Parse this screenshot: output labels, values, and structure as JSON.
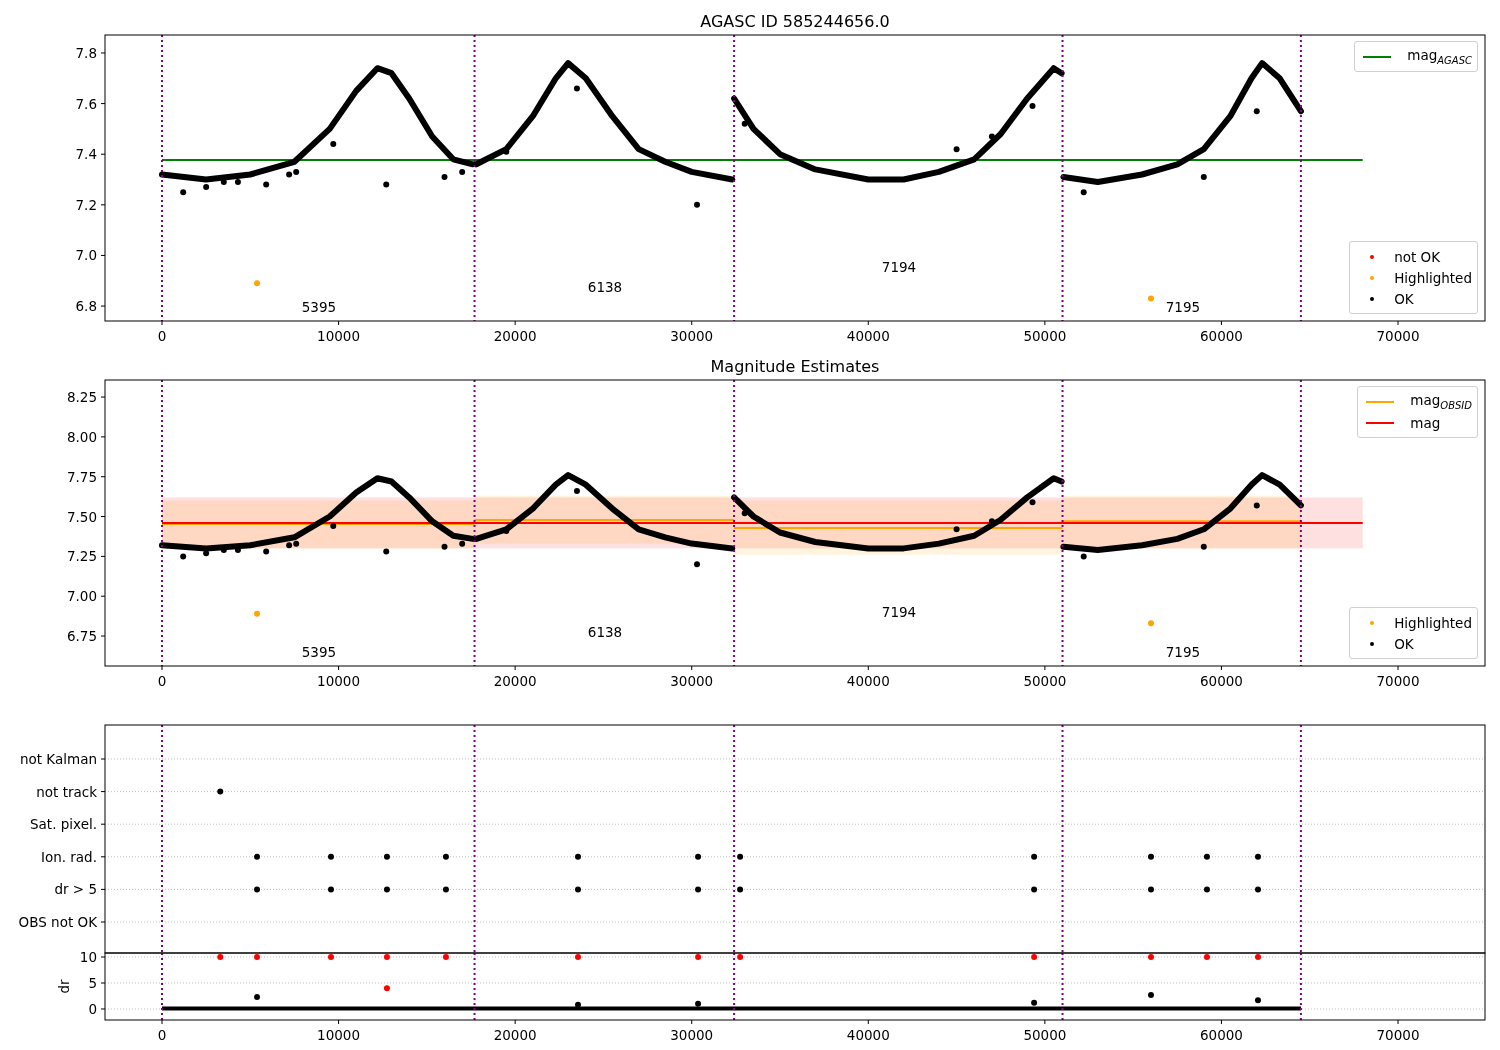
{
  "panels": [
    {
      "chart_data": {
        "type": "scatter",
        "title": "AGASC ID 585244656.0",
        "xlim": [
          -3228,
          74926
        ],
        "ylim": [
          6.741,
          7.871
        ],
        "xticks": [
          0,
          10000,
          20000,
          30000,
          40000,
          50000,
          60000,
          70000
        ],
        "yticks": [
          {
            "value": 6.8,
            "label": "6.8"
          },
          {
            "value": 7.0,
            "label": "7.0"
          },
          {
            "value": 7.2,
            "label": "7.2"
          },
          {
            "value": 7.4,
            "label": "7.4"
          },
          {
            "value": 7.6,
            "label": "7.6"
          },
          {
            "value": 7.8,
            "label": "7.8"
          }
        ],
        "series": [
          {
            "name": "mag$_{AGASC}$",
            "type": "line",
            "color": "#008000",
            "x": [
              0,
              68000
            ],
            "values": [
              7.377,
              7.377
            ]
          },
          {
            "name": "not OK",
            "type": "scatter",
            "color": "#ff0000"
          },
          {
            "type": "line",
            "color": "#000000",
            "x": [
              0,
              2500,
              5000,
              7500,
              9500,
              11000,
              12200,
              13000,
              14000,
              15300,
              16500,
              17600,
              17650,
              17800,
              19500,
              21000,
              22300,
              23000,
              24000,
              25500,
              27000,
              28500,
              30000,
              32300,
              32350,
              32400,
              33500,
              35000,
              37000,
              40000,
              42000,
              44000,
              46000,
              47500,
              49000,
              50500,
              50950,
              50975,
              51050,
              53000,
              55500,
              57500,
              59000,
              60500,
              61700,
              62300,
              63300,
              64500
            ],
            "values": [
              7.32,
              7.3,
              7.32,
              7.37,
              7.5,
              7.65,
              7.74,
              7.72,
              7.62,
              7.47,
              7.38,
              7.36,
              null,
              7.36,
              7.42,
              7.55,
              7.7,
              7.76,
              7.7,
              7.55,
              7.42,
              7.37,
              7.33,
              7.3,
              null,
              7.62,
              7.5,
              7.4,
              7.34,
              7.3,
              7.3,
              7.33,
              7.38,
              7.48,
              7.62,
              7.74,
              7.72,
              null,
              7.31,
              7.29,
              7.32,
              7.36,
              7.42,
              7.55,
              7.7,
              7.76,
              7.7,
              7.57
            ]
          },
          {
            "name": "Highlighted",
            "type": "scatter",
            "color": "#ffa500",
            "x": [
              5380,
              56010
            ],
            "values": [
              6.89,
              6.83
            ]
          },
          {
            "name": "OK",
            "type": "scatter",
            "color": "#000000",
            "x": [
              1200,
              2500,
              3500,
              4300,
              5900,
              7200,
              7600,
              9700,
              12700,
              16000,
              17000,
              19500,
              23500,
              30300,
              33000,
              45000,
              47000,
              49300,
              52200,
              59000,
              62000
            ],
            "values": [
              7.25,
              7.27,
              7.29,
              7.29,
              7.28,
              7.32,
              7.33,
              7.44,
              7.28,
              7.31,
              7.33,
              7.41,
              7.66,
              7.2,
              7.52,
              7.42,
              7.47,
              7.59,
              7.25,
              7.31,
              7.57
            ]
          }
        ],
        "ref_lines": [
          {
            "axis": "x",
            "value": 0
          },
          {
            "axis": "x",
            "value": 17700
          },
          {
            "axis": "x",
            "value": 32400
          },
          {
            "axis": "x",
            "value": 51000
          },
          {
            "axis": "x",
            "value": 64500
          }
        ],
        "annotations": [
          "5395",
          "6138",
          "7194",
          "7195"
        ]
      }
    },
    {
      "chart_data": {
        "type": "scatter",
        "title": "Magnitude Estimates",
        "xlim": [
          -3228,
          74926
        ],
        "ylim": [
          6.562,
          8.357
        ],
        "xticks": [
          0,
          10000,
          20000,
          30000,
          40000,
          50000,
          60000,
          70000
        ],
        "yticks": [
          {
            "value": 6.75,
            "label": "6.75"
          },
          {
            "value": 7.0,
            "label": "7.00"
          },
          {
            "value": 7.25,
            "label": "7.25"
          },
          {
            "value": 7.5,
            "label": "7.50"
          },
          {
            "value": 7.75,
            "label": "7.75"
          },
          {
            "value": 8.0,
            "label": "8.00"
          },
          {
            "value": 8.25,
            "label": "8.25"
          }
        ],
        "bands": [
          {
            "axis": "y",
            "from": 7.3,
            "to": 7.62,
            "color": "#ff0000"
          },
          {
            "axis": "y",
            "from": 7.3,
            "to": 7.6,
            "color": "#ffa500"
          },
          {
            "axis": "y",
            "from": 7.33,
            "to": 7.63,
            "color": "#ffa500"
          },
          {
            "axis": "y",
            "from": 7.26,
            "to": 7.6,
            "color": "#ffa500"
          },
          {
            "axis": "y",
            "from": 7.3,
            "to": 7.63,
            "color": "#ffa500"
          }
        ],
        "series": [
          {
            "name": "mag$_{OBSID}$",
            "type": "line",
            "color": "#ffa500",
            "x": [
              0,
              17700
            ],
            "values": [
              7.453,
              7.453
            ]
          },
          {
            "type": "line",
            "color": "#ffa500",
            "x": [
              17700,
              32400
            ],
            "values": [
              7.478,
              7.478
            ]
          },
          {
            "type": "line",
            "color": "#ffa500",
            "x": [
              32400,
              51000
            ],
            "values": [
              7.428,
              7.428
            ]
          },
          {
            "type": "line",
            "color": "#ffa500",
            "x": [
              51000,
              64500
            ],
            "values": [
              7.47,
              7.47
            ]
          },
          {
            "name": "mag",
            "type": "line",
            "color": "#ff0000",
            "x": [
              0,
              68000
            ],
            "values": [
              7.459,
              7.459
            ]
          },
          {
            "type": "line",
            "color": "#000000",
            "x": [
              0,
              2500,
              5000,
              7500,
              9500,
              11000,
              12200,
              13000,
              14000,
              15300,
              16500,
              17600,
              17650,
              17800,
              19500,
              21000,
              22300,
              23000,
              24000,
              25500,
              27000,
              28500,
              30000,
              32300,
              32350,
              32400,
              33500,
              35000,
              37000,
              40000,
              42000,
              44000,
              46000,
              47500,
              49000,
              50500,
              50950,
              50975,
              51050,
              53000,
              55500,
              57500,
              59000,
              60500,
              61700,
              62300,
              63300,
              64500
            ],
            "values": [
              7.32,
              7.3,
              7.32,
              7.37,
              7.5,
              7.65,
              7.74,
              7.72,
              7.62,
              7.47,
              7.38,
              7.36,
              null,
              7.36,
              7.42,
              7.55,
              7.7,
              7.76,
              7.7,
              7.55,
              7.42,
              7.37,
              7.33,
              7.3,
              null,
              7.62,
              7.5,
              7.4,
              7.34,
              7.3,
              7.3,
              7.33,
              7.38,
              7.48,
              7.62,
              7.74,
              7.72,
              null,
              7.31,
              7.29,
              7.32,
              7.36,
              7.42,
              7.55,
              7.7,
              7.76,
              7.7,
              7.57
            ]
          },
          {
            "name": "Highlighted",
            "type": "scatter",
            "color": "#ffa500",
            "x": [
              5380,
              56010
            ],
            "values": [
              6.89,
              6.83
            ]
          },
          {
            "name": "OK",
            "type": "scatter",
            "color": "#000000",
            "x": [
              1200,
              2500,
              3500,
              4300,
              5900,
              7200,
              7600,
              9700,
              12700,
              16000,
              17000,
              19500,
              23500,
              30300,
              33000,
              45000,
              47000,
              49300,
              52200,
              59000,
              62000
            ],
            "values": [
              7.25,
              7.27,
              7.29,
              7.29,
              7.28,
              7.32,
              7.33,
              7.44,
              7.28,
              7.31,
              7.33,
              7.41,
              7.66,
              7.2,
              7.52,
              7.42,
              7.47,
              7.59,
              7.25,
              7.31,
              7.57
            ]
          }
        ],
        "ref_lines": [
          {
            "axis": "x",
            "value": 0
          },
          {
            "axis": "x",
            "value": 17700
          },
          {
            "axis": "x",
            "value": 32400
          },
          {
            "axis": "x",
            "value": 51000
          },
          {
            "axis": "x",
            "value": 64500
          }
        ],
        "annotations": [
          "5395",
          "6138",
          "7194",
          "7195"
        ]
      }
    },
    {
      "chart_data": {
        "type": "scatter",
        "orientation": "horizontal",
        "grid": true,
        "xlim": [
          -3228,
          74926
        ],
        "categories": [
          "not Kalman",
          "not track",
          "Sat. pixel.",
          "Ion. rad.",
          "dr > 5",
          "OBS not OK"
        ],
        "series": [
          {
            "type": "scatter",
            "color": "#000000",
            "values": [
              null,
              3300,
              null,
              null,
              null,
              null
            ]
          },
          {
            "type": "scatter",
            "color": "#000000",
            "values": [
              null,
              null,
              null,
              5380,
              5380,
              null
            ]
          },
          {
            "type": "scatter",
            "color": "#000000",
            "values": [
              null,
              null,
              null,
              9570,
              9570,
              null
            ]
          },
          {
            "type": "scatter",
            "color": "#000000",
            "values": [
              null,
              null,
              null,
              12740,
              12740,
              null
            ]
          },
          {
            "type": "scatter",
            "color": "#000000",
            "values": [
              null,
              null,
              null,
              16080,
              16080,
              null
            ]
          },
          {
            "type": "scatter",
            "color": "#000000",
            "values": [
              null,
              null,
              null,
              23560,
              23560,
              null
            ]
          },
          {
            "type": "scatter",
            "color": "#000000",
            "values": [
              null,
              null,
              null,
              30360,
              30360,
              null
            ]
          },
          {
            "type": "scatter",
            "color": "#000000",
            "values": [
              null,
              null,
              null,
              32740,
              32740,
              null
            ]
          },
          {
            "type": "scatter",
            "color": "#000000",
            "values": [
              null,
              null,
              null,
              49390,
              49390,
              null
            ]
          },
          {
            "type": "scatter",
            "color": "#000000",
            "values": [
              null,
              null,
              null,
              56010,
              56010,
              null
            ]
          },
          {
            "type": "scatter",
            "color": "#000000",
            "values": [
              null,
              null,
              null,
              59180,
              59180,
              null
            ]
          },
          {
            "type": "scatter",
            "color": "#000000",
            "values": [
              null,
              null,
              null,
              62070,
              62070,
              null
            ]
          }
        ],
        "ref_lines": [
          {
            "axis": "x",
            "value": 0
          },
          {
            "axis": "x",
            "value": 17700
          },
          {
            "axis": "x",
            "value": 32400
          },
          {
            "axis": "x",
            "value": 51000
          },
          {
            "axis": "x",
            "value": 64500
          }
        ]
      }
    },
    {
      "chart_data": {
        "type": "scatter",
        "ylabel": "dr",
        "grid": true,
        "xlim": [
          -3228,
          74926
        ],
        "ylim": [
          -2.12,
          10.77
        ],
        "xticks": [
          0,
          10000,
          20000,
          30000,
          40000,
          50000,
          60000,
          70000
        ],
        "yticks": [
          0,
          5,
          10
        ],
        "series": [
          {
            "type": "line",
            "color": "#000000",
            "x": [
              0,
              64500
            ],
            "values": [
              0.1,
              0.1
            ]
          },
          {
            "type": "scatter",
            "color": "#000000",
            "x": [
              5380,
              23560,
              30360,
              49390,
              56010,
              62070
            ],
            "values": [
              2.3,
              0.8,
              1.0,
              1.2,
              2.7,
              1.7
            ]
          },
          {
            "type": "scatter",
            "color": "#ff0000",
            "x": [
              3300,
              5380,
              9570,
              12740,
              12740,
              16080,
              23560,
              30360,
              32740,
              49390,
              56010,
              59180,
              62070
            ],
            "values": [
              10,
              10,
              10,
              10,
              4.0,
              10,
              10,
              10,
              10,
              10,
              10,
              10,
              10
            ]
          }
        ],
        "ref_lines": [
          {
            "axis": "x",
            "value": 0
          },
          {
            "axis": "x",
            "value": 17700
          },
          {
            "axis": "x",
            "value": 32400
          },
          {
            "axis": "x",
            "value": 51000
          },
          {
            "axis": "x",
            "value": 64500
          }
        ]
      }
    }
  ]
}
